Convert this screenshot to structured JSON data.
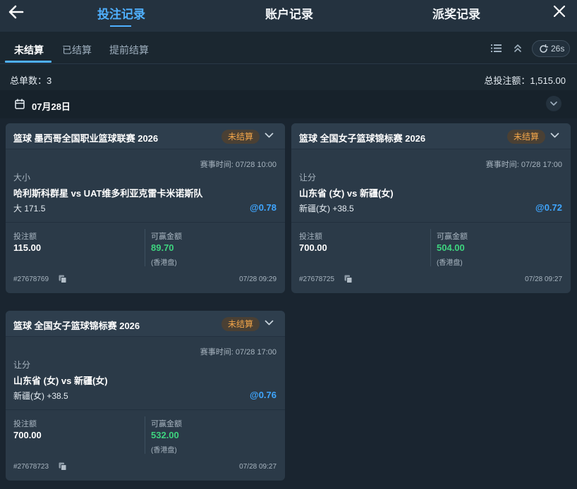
{
  "header": {
    "tabs": [
      {
        "label": "投注记录",
        "active": true
      },
      {
        "label": "账户记录",
        "active": false
      },
      {
        "label": "派奖记录",
        "active": false
      }
    ],
    "icons": {
      "back": "arrow-left-icon",
      "close": "close-icon"
    }
  },
  "subtabs": {
    "items": [
      "未结算",
      "已结算",
      "提前结算"
    ],
    "active_index": 0,
    "refresh_label": "26s"
  },
  "summary": {
    "count_text": "总单数：3",
    "total_text": "总投注额：1,515.00"
  },
  "date": {
    "label": "07月28日"
  },
  "colors": {
    "accent": "#4fb0ff",
    "odds": "#3fa6ff",
    "win": "#3ed47f",
    "badge_text": "#f3a64a",
    "badge_bg": "#4a4034",
    "card_bg": "#2b3a48"
  },
  "cards": [
    {
      "title": "篮球 墨西哥全国职业篮球联赛 2026",
      "status": "未结算",
      "match_time": "赛事时间: 07/28 10:00",
      "market": "大小",
      "teams": "哈利斯科群星 vs UAT维多利亚克雷卡米诺斯队",
      "selection": "大 171.5",
      "odds": "@0.78",
      "stake_label": "投注额",
      "stake": "115.00",
      "win_label": "可赢金额",
      "win": "89.70",
      "win_note": "(香港盘)",
      "bet_id": "#27678769",
      "bet_time": "07/28 09:29"
    },
    {
      "title": "篮球 全国女子篮球锦标赛 2026",
      "status": "未结算",
      "match_time": "赛事时间: 07/28 17:00",
      "market": "让分",
      "teams": "山东省 (女) vs 新疆(女)",
      "selection": "新疆(女) +38.5",
      "odds": "@0.72",
      "stake_label": "投注额",
      "stake": "700.00",
      "win_label": "可赢金额",
      "win": "504.00",
      "win_note": "(香港盘)",
      "bet_id": "#27678725",
      "bet_time": "07/28 09:27"
    },
    {
      "title": "篮球 全国女子篮球锦标赛 2026",
      "status": "未结算",
      "match_time": "赛事时间: 07/28 17:00",
      "market": "让分",
      "teams": "山东省 (女) vs 新疆(女)",
      "selection": "新疆(女) +38.5",
      "odds": "@0.76",
      "stake_label": "投注额",
      "stake": "700.00",
      "win_label": "可赢金额",
      "win": "532.00",
      "win_note": "(香港盘)",
      "bet_id": "#27678723",
      "bet_time": "07/28 09:27"
    }
  ]
}
